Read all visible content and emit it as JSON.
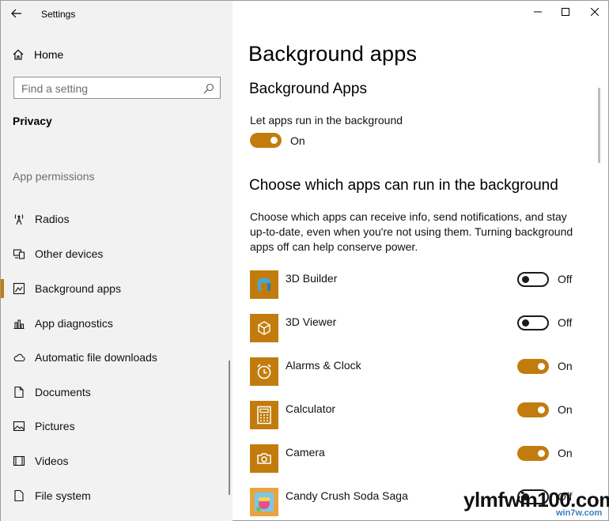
{
  "window": {
    "title": "Settings",
    "controls": [
      "minimize",
      "maximize",
      "close"
    ]
  },
  "sidebar": {
    "home_label": "Home",
    "search_placeholder": "Find a setting",
    "section_title": "Privacy",
    "group_title": "App permissions",
    "items": [
      {
        "label": "Radios",
        "icon": "radio-icon"
      },
      {
        "label": "Other devices",
        "icon": "devices-icon"
      },
      {
        "label": "Background apps",
        "icon": "background-apps-icon",
        "active": true
      },
      {
        "label": "App diagnostics",
        "icon": "app-diagnostics-icon"
      },
      {
        "label": "Automatic file downloads",
        "icon": "cloud-icon"
      },
      {
        "label": "Documents",
        "icon": "document-icon"
      },
      {
        "label": "Pictures",
        "icon": "picture-icon"
      },
      {
        "label": "Videos",
        "icon": "video-icon"
      },
      {
        "label": "File system",
        "icon": "file-icon"
      }
    ]
  },
  "main": {
    "title": "Background apps",
    "subheading": "Background Apps",
    "master_setting_label": "Let apps run in the background",
    "master_toggle_state": "On",
    "section_heading": "Choose which apps can run in the background",
    "description": "Choose which apps can receive info, send notifications, and stay up-to-date, even when you're not using them. Turning background apps off can help conserve power.",
    "apps": [
      {
        "name": "3D Builder",
        "state": "Off",
        "icon": "3d-builder-icon"
      },
      {
        "name": "3D Viewer",
        "state": "Off",
        "icon": "3d-viewer-icon"
      },
      {
        "name": "Alarms & Clock",
        "state": "On",
        "icon": "alarm-clock-icon"
      },
      {
        "name": "Calculator",
        "state": "On",
        "icon": "calculator-icon"
      },
      {
        "name": "Camera",
        "state": "On",
        "icon": "camera-icon"
      },
      {
        "name": "Candy Crush Soda Saga",
        "state": "Off",
        "icon": "candy-crush-icon"
      }
    ]
  },
  "colors": {
    "accent": "#c27c0e",
    "sidebar_bg": "#f2f2f2"
  },
  "watermark": {
    "text": "ylmfwin100.com",
    "subtext": "win7w.com"
  }
}
